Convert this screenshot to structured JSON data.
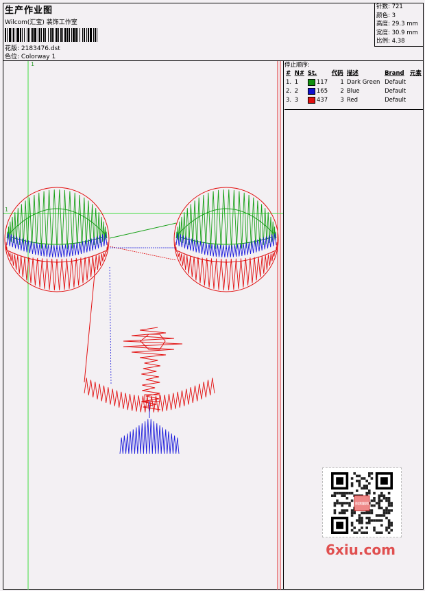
{
  "header": {
    "title": "生产作业图",
    "company": "Wilcom(汇宝) 装饰工作室",
    "design_label": "花版:",
    "design_value": "2183476.dst",
    "colorway_label": "色位:",
    "colorway_value": "Colorway 1"
  },
  "stats": [
    {
      "label": "针数:",
      "value": "721"
    },
    {
      "label": "颜色:",
      "value": "3"
    },
    {
      "label": "高度:",
      "value": "29.3 mm"
    },
    {
      "label": "宽度:",
      "value": "30.9 mm"
    },
    {
      "label": "比例:",
      "value": "4.38"
    }
  ],
  "stop_sequence": {
    "label": "停止顺序:",
    "columns": [
      "#",
      "N#",
      "St.",
      "代码",
      "描述",
      "Brand",
      "元素"
    ],
    "rows": [
      {
        "idx": "1.",
        "n": "1",
        "color": "#109010",
        "st": "117",
        "code": "1",
        "desc": "Dark Green",
        "brand": "Default"
      },
      {
        "idx": "2.",
        "n": "2",
        "color": "#1010d0",
        "st": "165",
        "code": "2",
        "desc": "Blue",
        "brand": "Default"
      },
      {
        "idx": "3.",
        "n": "3",
        "color": "#e01010",
        "st": "437",
        "code": "3",
        "desc": "Red",
        "brand": "Default"
      }
    ]
  },
  "guides": {
    "x_label": "1",
    "y_label": "1"
  },
  "colors": {
    "green": "#16a016",
    "blue": "#1a1adc",
    "red": "#e21010",
    "guide": "#3cdc3c",
    "page_red": "#e03030"
  },
  "watermark": "6xiu.com",
  "qr_badge": "刺绣图网"
}
